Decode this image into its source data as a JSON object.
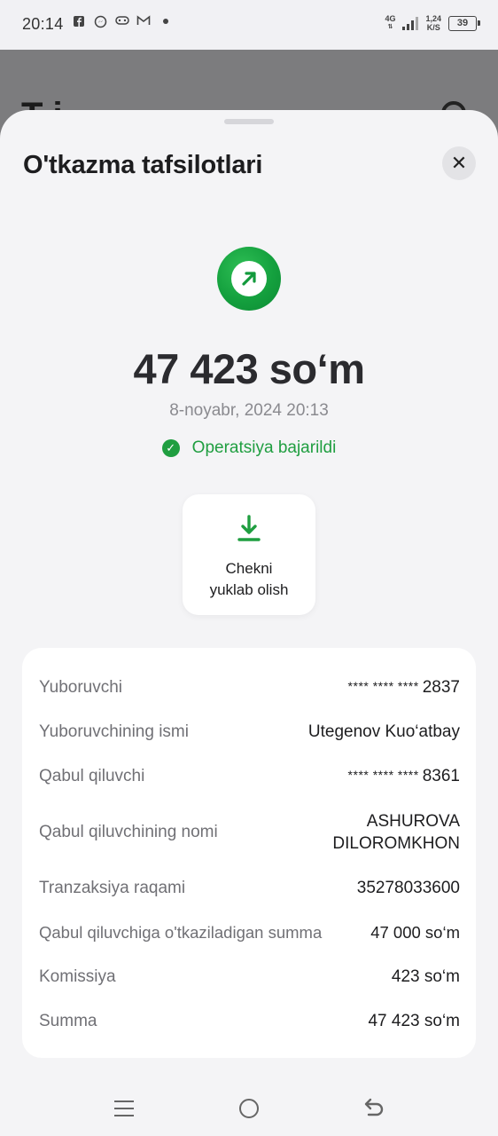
{
  "status_bar": {
    "time": "20:14",
    "network": "4G",
    "speed_value": "1,24",
    "speed_unit": "K/S",
    "battery": "39"
  },
  "background": {
    "title_partial": "T i"
  },
  "sheet": {
    "title": "O'tkazma tafsilotlari",
    "close_icon": "✕",
    "amount": "47 423 so‘m",
    "datetime": "8-noyabr, 2024 20:13",
    "status_text": "Operatsiya bajarildi",
    "receipt_button": {
      "line1": "Chekni",
      "line2": "yuklab olish"
    },
    "details": [
      {
        "label": "Yuboruvchi",
        "mask": "**** **** ****",
        "value": "2837"
      },
      {
        "label": "Yuboruvchining ismi",
        "value": "Utegenov Kuo‘atbay"
      },
      {
        "label": "Qabul qiluvchi",
        "mask": "**** **** ****",
        "value": "8361"
      },
      {
        "label": "Qabul qiluvchining nomi",
        "value_line1": "ASHUROVA",
        "value_line2": "DILOROMKHON"
      },
      {
        "label": "Tranzaksiya raqami",
        "value": "35278033600"
      },
      {
        "label": "Qabul qiluvchiga o'tkaziladigan summa",
        "value": "47 000 so‘m"
      },
      {
        "label": "Komissiya",
        "value": "423 so‘m"
      },
      {
        "label": "Summa",
        "value": "47 423 so‘m"
      }
    ]
  },
  "colors": {
    "success_green": "#1f9e40",
    "background_dim": "#7c7c7e",
    "fab_green": "#8fd09a"
  },
  "icons": {
    "status": "arrow-up-right-icon",
    "status_check": "check-circle-icon",
    "download": "download-icon",
    "nav_menu": "menu-icon",
    "nav_home": "home-icon",
    "nav_back": "back-icon"
  }
}
